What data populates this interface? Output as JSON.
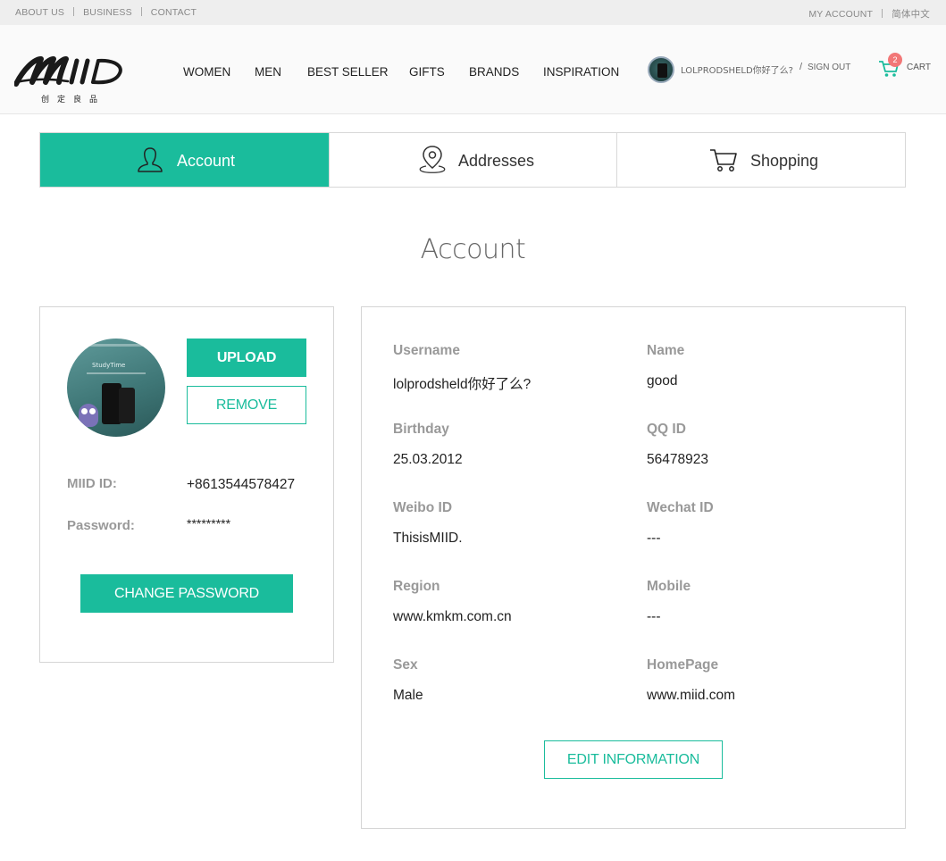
{
  "topbar": {
    "left": [
      "ABOUT US",
      "BUSINESS",
      "CONTACT"
    ],
    "right": [
      "MY ACCOUNT",
      "简体中文"
    ]
  },
  "brand": {
    "logo_text": "MiiD",
    "tagline": "创定良品"
  },
  "nav": [
    "WOMEN",
    "MEN",
    "BEST SELLER",
    "GIFTS",
    "BRANDS",
    "INSPIRATION"
  ],
  "user": {
    "name": "LOLPRODSHELD你好了么?",
    "separator": "/",
    "sign_out": "SIGN OUT"
  },
  "cart": {
    "count": "2",
    "label": "CART"
  },
  "tabs": [
    {
      "label": "Account",
      "icon": "user-icon",
      "active": true
    },
    {
      "label": "Addresses",
      "icon": "map-pin-icon",
      "active": false
    },
    {
      "label": "Shopping",
      "icon": "shopping-cart-icon",
      "active": false
    }
  ],
  "page_title": "Account",
  "profile": {
    "photo_title": "StudyTime",
    "upload_label": "UPLOAD",
    "remove_label": "REMOVE",
    "miid_label": "MIID ID:",
    "miid_value": "+8613544578427",
    "password_label": "Password:",
    "password_value": "*********",
    "change_password_label": "CHANGE PASSWORD"
  },
  "info": [
    {
      "label": "Username",
      "value": "lolprodsheld你好了么?"
    },
    {
      "label": "Name",
      "value": "good"
    },
    {
      "label": "Birthday",
      "value": "25.03.2012"
    },
    {
      "label": "QQ ID",
      "value": "56478923"
    },
    {
      "label": "Weibo ID",
      "value": "ThisisMIID."
    },
    {
      "label": "Wechat ID",
      "value": "---"
    },
    {
      "label": "Region",
      "value": "www.kmkm.com.cn"
    },
    {
      "label": "Mobile",
      "value": "---"
    },
    {
      "label": "Sex",
      "value": "Male"
    },
    {
      "label": "HomePage",
      "value": "www.miid.com"
    }
  ],
  "edit_label": "EDIT INFORMATION",
  "colors": {
    "accent": "#1abc9c",
    "badge": "#f27777",
    "topbar_bg": "#eeeeee"
  }
}
